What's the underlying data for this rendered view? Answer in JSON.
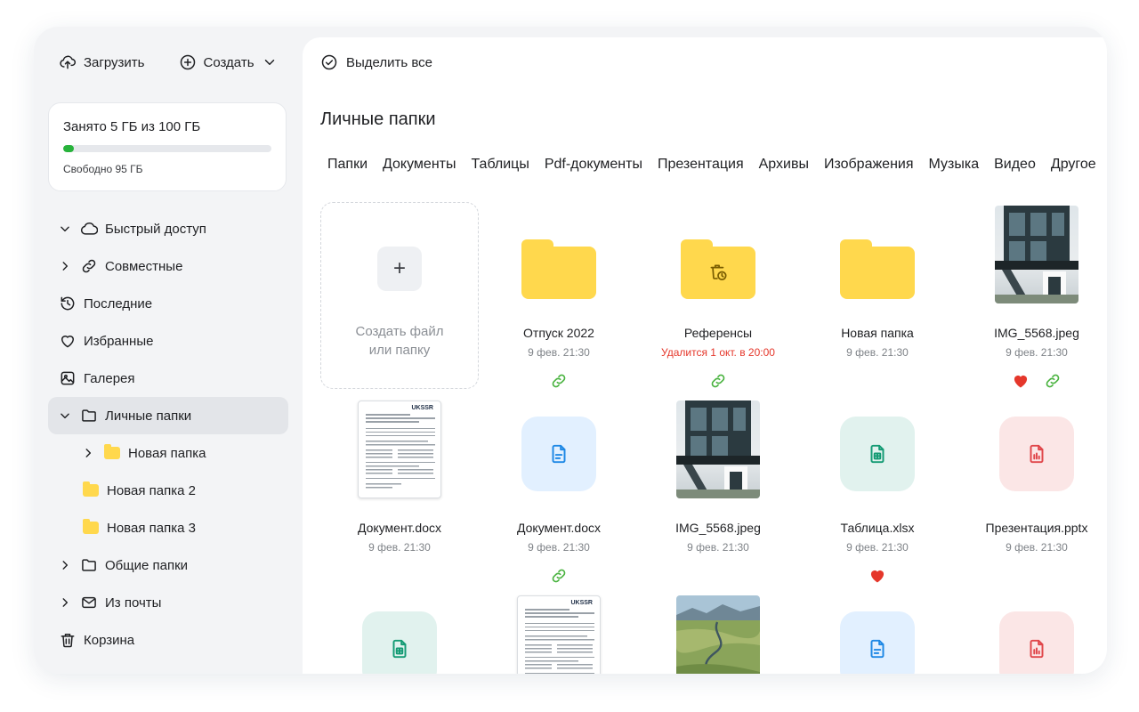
{
  "toolbar": {
    "upload_label": "Загрузить",
    "create_label": "Создать"
  },
  "storage": {
    "used_text": "Занято 5 ГБ из 100 ГБ",
    "free_text": "Свободно 95 ГБ",
    "used_fraction": 0.05,
    "accent_color": "#27b33b"
  },
  "sidebar": {
    "items": [
      {
        "label": "Быстрый доступ",
        "icon": "cloud-icon",
        "chevron": "down"
      },
      {
        "label": "Совместные",
        "icon": "link-icon",
        "chevron": "right"
      },
      {
        "label": "Последние",
        "icon": "history-icon"
      },
      {
        "label": "Избранные",
        "icon": "heart-icon"
      },
      {
        "label": "Галерея",
        "icon": "gallery-icon"
      },
      {
        "label": "Личные папки",
        "icon": "folder-icon",
        "chevron": "down",
        "active": true
      },
      {
        "label": "Новая папка",
        "icon": "folder-filled-icon",
        "chevron": "right"
      },
      {
        "label": "Новая папка 2",
        "icon": "folder-filled-icon"
      },
      {
        "label": "Новая папка 3",
        "icon": "folder-filled-icon"
      },
      {
        "label": "Общие папки",
        "icon": "folder-icon",
        "chevron": "right"
      },
      {
        "label": "Из почты",
        "icon": "mail-icon",
        "chevron": "right"
      },
      {
        "label": "Корзина",
        "icon": "trash-icon"
      }
    ]
  },
  "main": {
    "select_all_label": "Выделить все",
    "title": "Личные папки",
    "tabs": [
      "Папки",
      "Документы",
      "Таблицы",
      "Pdf-документы",
      "Презентация",
      "Архивы",
      "Изображения",
      "Музыка",
      "Видео",
      "Другое"
    ],
    "create_tile": {
      "line1": "Создать файл",
      "line2": "или папку"
    },
    "files": [
      {
        "name": "Отпуск 2022",
        "date": "9 фев. 21:30",
        "kind": "folder",
        "link": true
      },
      {
        "name": "Референсы",
        "date": "Удалится 1 окт. в 20:00",
        "kind": "folder-timer",
        "link": true,
        "warn": true
      },
      {
        "name": "Новая папка",
        "date": "9 фев. 21:30",
        "kind": "folder"
      },
      {
        "name": "IMG_5568.jpeg",
        "date": "9 фев. 21:30",
        "kind": "photo-house",
        "favorite": true,
        "link": true
      },
      {
        "name": "Документ.docx",
        "date": "9 фев. 21:30",
        "kind": "doc-preview"
      },
      {
        "name": "Документ.docx",
        "date": "9 фев. 21:30",
        "kind": "doc-icon",
        "link": true
      },
      {
        "name": "IMG_5568.jpeg",
        "date": "9 фев. 21:30",
        "kind": "photo-house"
      },
      {
        "name": "Таблица.xlsx",
        "date": "9 фев. 21:30",
        "kind": "xls-icon",
        "favorite": true
      },
      {
        "name": "Презентация.pptx",
        "date": "9 фев. 21:30",
        "kind": "ppt-icon"
      }
    ],
    "doc_preview_brand": "UKSSR",
    "colors": {
      "folder": "#ffd84d",
      "link": "#49b33f",
      "favorite": "#e5372b",
      "doc": "#1e88e5",
      "xls": "#149b74",
      "ppt": "#e0464a"
    }
  }
}
